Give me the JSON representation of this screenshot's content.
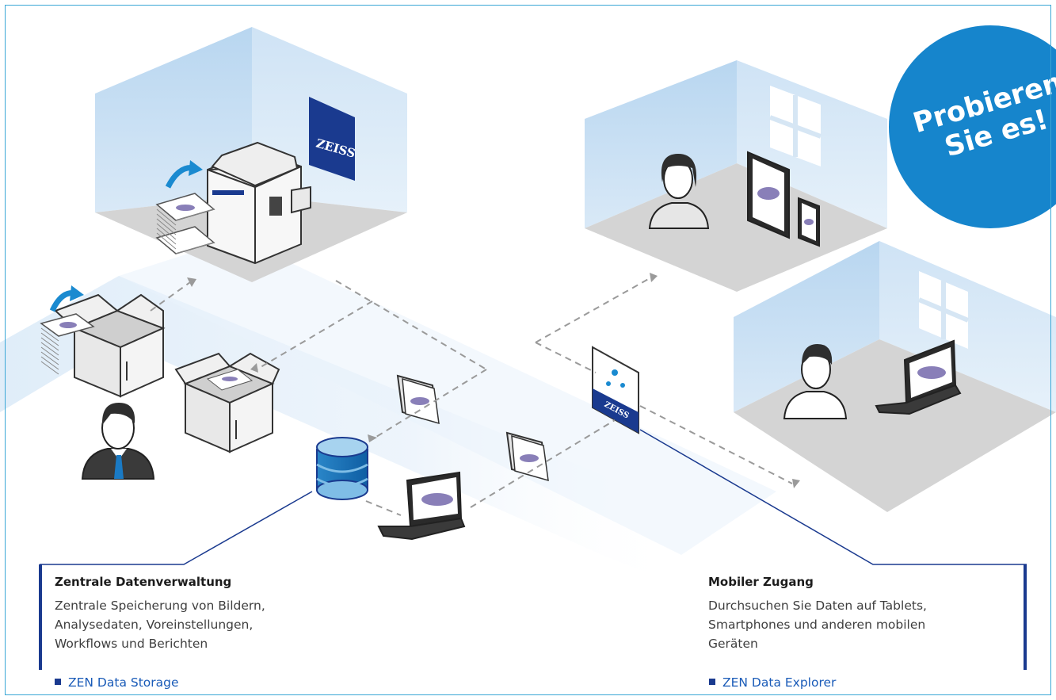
{
  "brand": {
    "logo_text": "ZEISS",
    "primary_color": "#1a3a8f",
    "accent_color": "#1685cc",
    "link_color": "#1a5bb8"
  },
  "badge": {
    "line1": "Probieren",
    "line2": "Sie es!"
  },
  "left_box": {
    "title": "Zentrale Datenverwaltung",
    "body": "Zentrale Speicherung von Bildern,\nAnalysedaten, Voreinstellungen,\nWorkflows und Berichten"
  },
  "right_box": {
    "title": "Mobiler Zugang",
    "body": "Durchsuchen Sie Daten auf Tablets,\nSmartphones und anderen mobilen\nGeräten"
  },
  "links": {
    "left": "ZEN Data Storage",
    "right": "ZEN Data Explorer"
  },
  "icons": [
    "microscope-scanner-icon",
    "slide-stack-icon",
    "box-icon",
    "person-icon",
    "database-icon",
    "laptop-icon",
    "folder-icon",
    "zen-app-icon",
    "tablet-icon",
    "phone-icon",
    "window-icon",
    "rotate-arrow-icon"
  ]
}
